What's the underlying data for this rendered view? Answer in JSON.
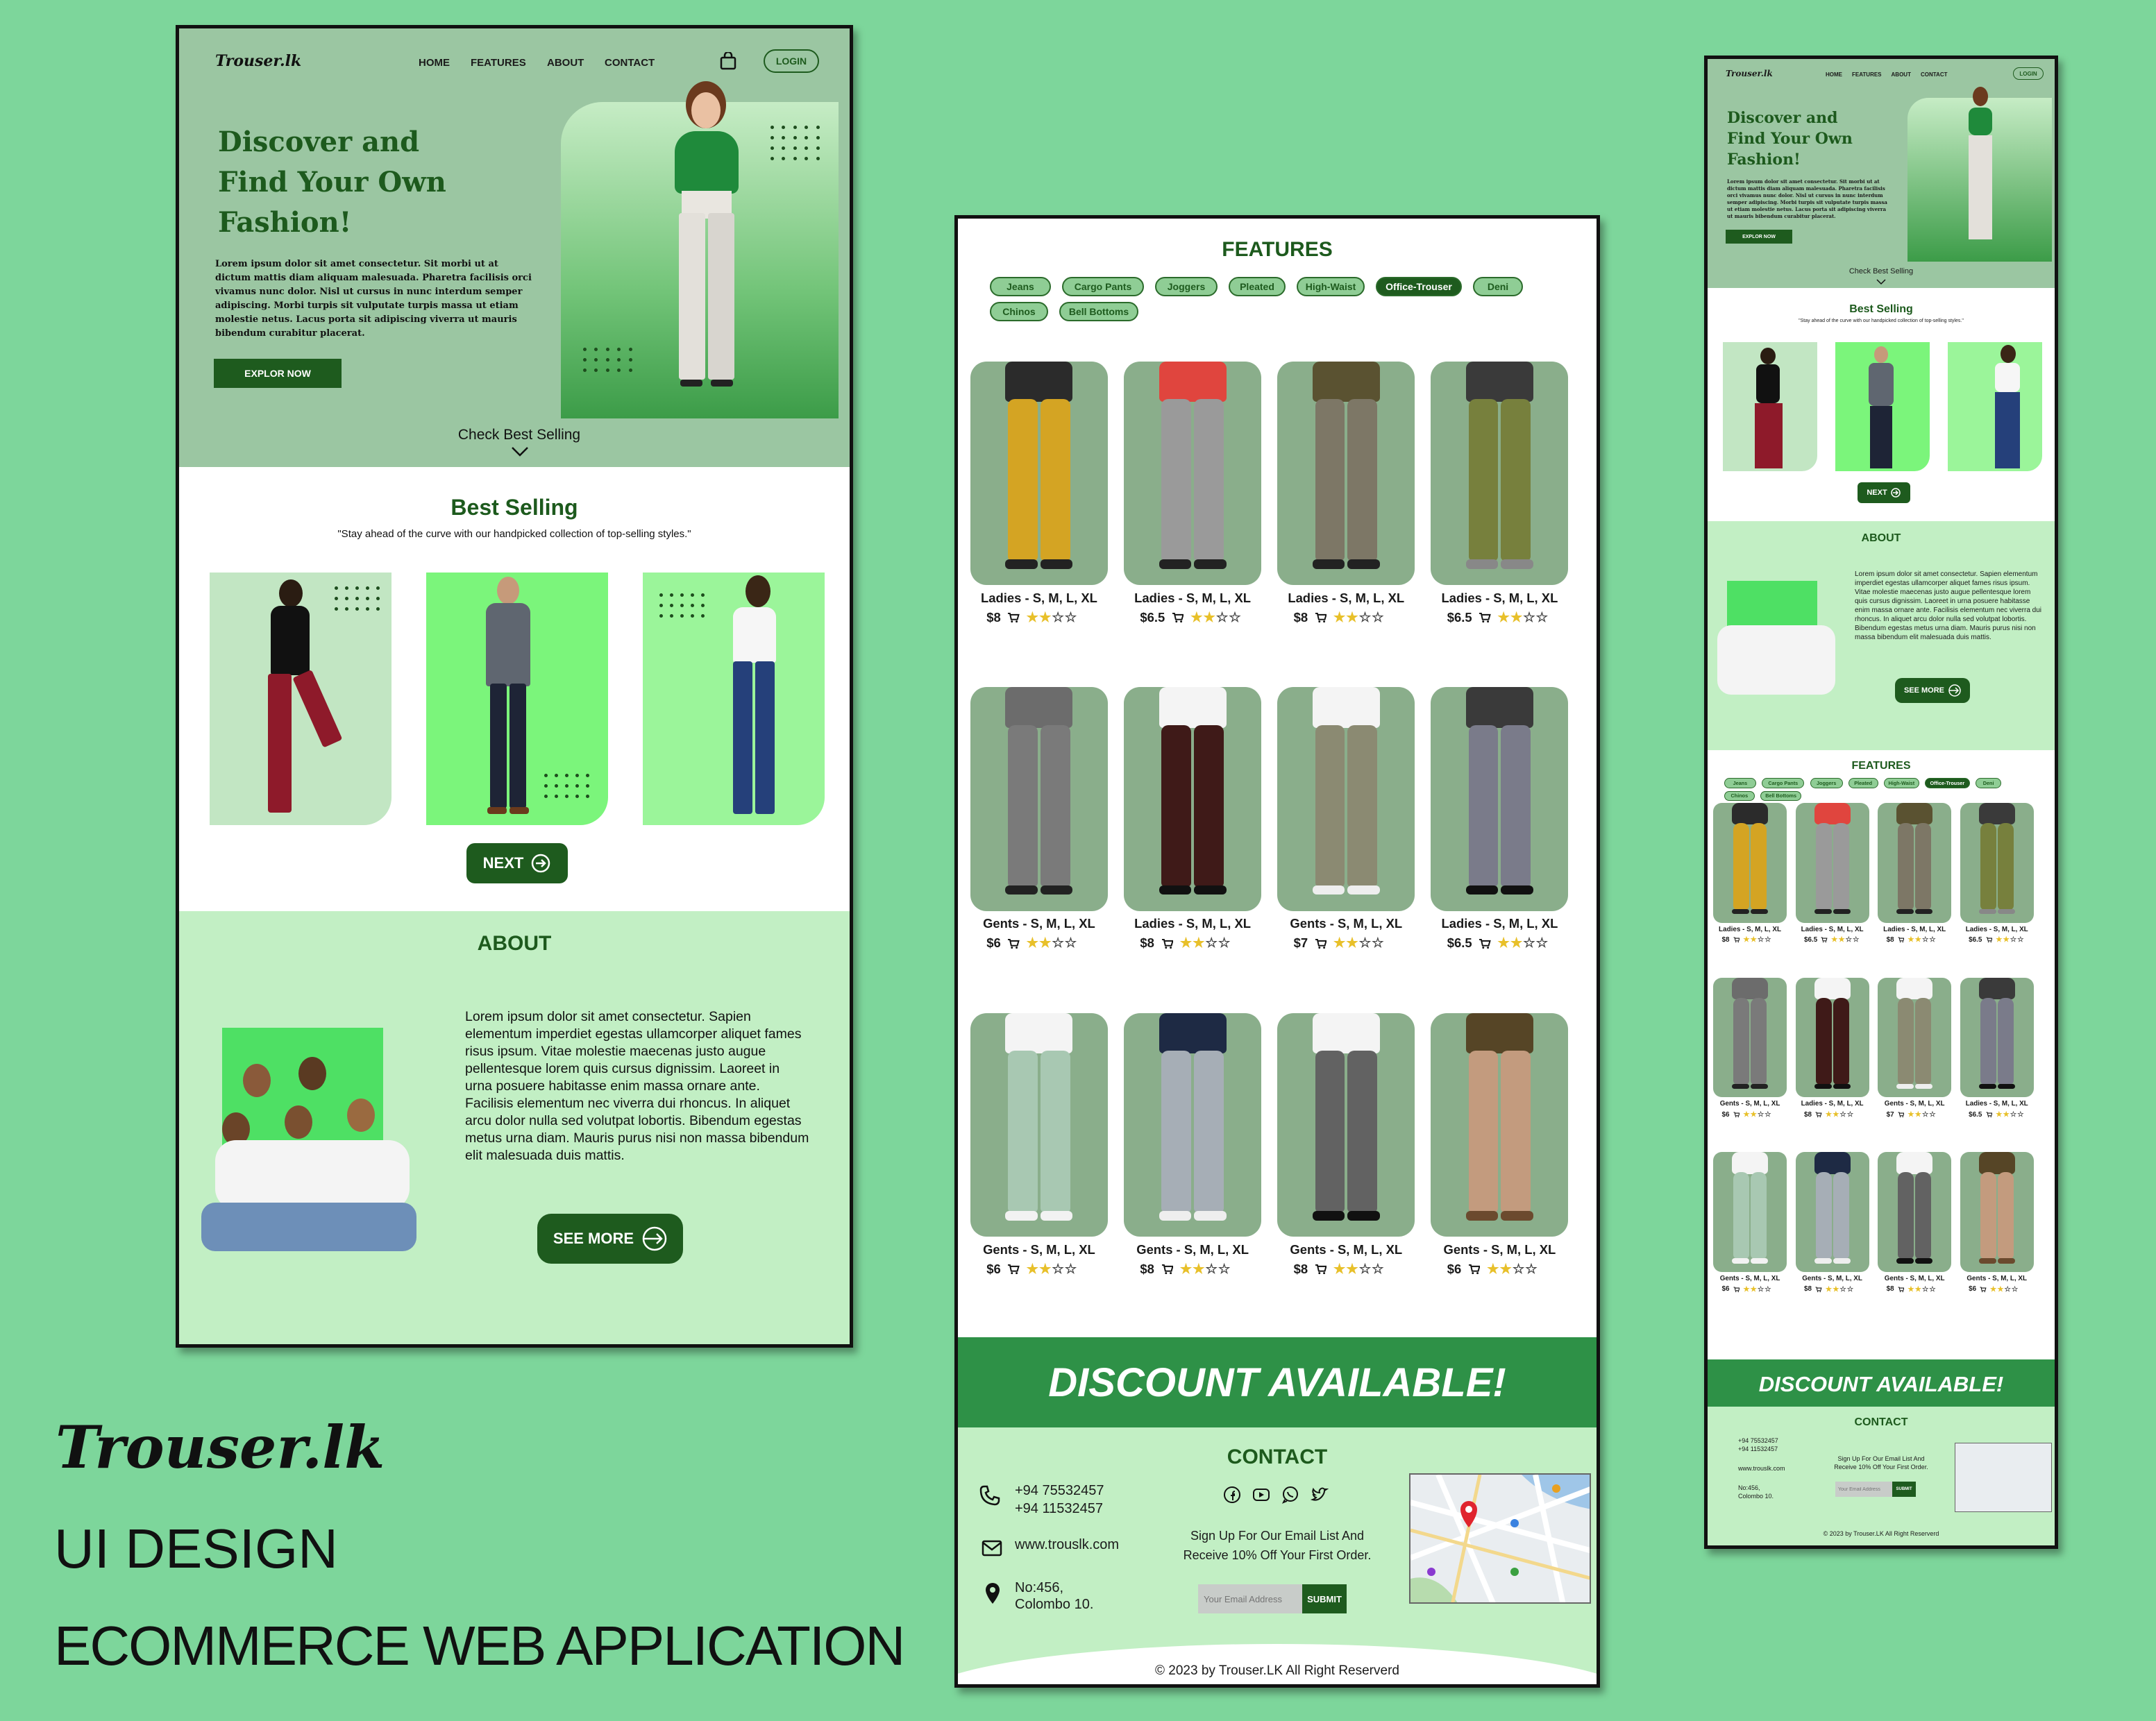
{
  "brand": {
    "title": "Trouser.lk",
    "line1": "UI DESIGN",
    "line2": "ECOMMERCE WEB APPLICATION"
  },
  "colors": {
    "page_bg": "#7dd69b",
    "hero_bg": "#9bc6a2",
    "accent_dark": "#1e5b1e",
    "light_green": "#c2efc4",
    "bright_green": "#7bf57b",
    "card_bg": "#8aae8b",
    "discount_bg": "#2e9147"
  },
  "nav": {
    "logo": "Trouser.lk",
    "items": [
      "HOME",
      "FEATURES",
      "ABOUT",
      "CONTACT"
    ],
    "cart_icon": "shopping-bag-icon",
    "login": "LOGIN"
  },
  "hero": {
    "title_l1": "Discover and",
    "title_l2": "Find Your Own",
    "title_l3": "Fashion!",
    "body": "Lorem ipsum dolor sit amet consectetur. Sit morbi ut at dictum mattis diam aliquam malesuada. Pharetra facilisis orci vivamus nunc dolor. Nisl ut cursus in nunc interdum semper adipiscing. Morbi turpis sit vulputate turpis massa ut etiam molestie netus. Lacus porta sit adipiscing viverra ut mauris bibendum curabitur placerat.",
    "cta": "EXPLOR NOW",
    "check": "Check Best Selling"
  },
  "best": {
    "title": "Best Selling",
    "subtitle": "\"Stay ahead of the curve with our handpicked collection of top-selling styles.\"",
    "next": "NEXT"
  },
  "about": {
    "title": "ABOUT",
    "body": "Lorem ipsum dolor sit amet consectetur. Sapien elementum imperdiet egestas ullamcorper aliquet fames risus ipsum. Vitae molestie maecenas justo augue pellentesque lorem quis cursus dignissim. Laoreet in urna posuere habitasse enim massa ornare ante. Facilisis elementum nec viverra dui rhoncus. In aliquet arcu dolor nulla sed volutpat lobortis. Bibendum egestas metus urna diam. Mauris purus nisi non massa bibendum elit malesuada duis mattis.",
    "cta": "SEE MORE"
  },
  "features": {
    "title": "FEATURES",
    "chips": [
      "Jeans",
      "Cargo Pants",
      "Joggers",
      "Pleated",
      "High-Waist",
      "Office-Trouser",
      "Deni",
      "Chinos",
      "Bell Bottoms"
    ],
    "active": "Office-Trouser"
  },
  "products": [
    {
      "label": "Ladies - S, M, L, XL",
      "price": "$8",
      "rating": 2,
      "top": "#2b2b2b",
      "pants": "#d4a423",
      "shoe": "#222"
    },
    {
      "label": "Ladies - S, M, L, XL",
      "price": "$6.5",
      "rating": 2,
      "top": "#e0453e",
      "pants": "#9a9a9a",
      "shoe": "#222"
    },
    {
      "label": "Ladies - S, M, L, XL",
      "price": "$8",
      "rating": 2,
      "top": "#5a5231",
      "pants": "#7d7766",
      "shoe": "#222"
    },
    {
      "label": "Ladies - S, M, L, XL",
      "price": "$6.5",
      "rating": 2,
      "top": "#3a3a3a",
      "pants": "#77803d",
      "shoe": "#888"
    },
    {
      "label": "Gents - S, M, L, XL",
      "price": "$6",
      "rating": 2,
      "top": "#6c6c6c",
      "pants": "#7a7a7a",
      "shoe": "#222"
    },
    {
      "label": "Ladies - S, M, L, XL",
      "price": "$8",
      "rating": 2,
      "top": "#f4f4f4",
      "pants": "#3f1a18",
      "shoe": "#111"
    },
    {
      "label": "Gents - S, M, L, XL",
      "price": "$7",
      "rating": 2,
      "top": "#f4f4f4",
      "pants": "#8b8a72",
      "shoe": "#eee"
    },
    {
      "label": "Ladies - S, M, L, XL",
      "price": "$6.5",
      "rating": 2,
      "top": "#3a3a3a",
      "pants": "#7a7b8a",
      "shoe": "#111"
    },
    {
      "label": "Gents - S, M, L, XL",
      "price": "$6",
      "rating": 2,
      "top": "#f4f4f4",
      "pants": "#a8c8b2",
      "shoe": "#f2f2f2"
    },
    {
      "label": "Gents - S, M, L, XL",
      "price": "$8",
      "rating": 2,
      "top": "#1e2a44",
      "pants": "#a6aeb6",
      "shoe": "#eee"
    },
    {
      "label": "Gents - S, M, L, XL",
      "price": "$8",
      "rating": 2,
      "top": "#f4f4f4",
      "pants": "#626262",
      "shoe": "#111"
    },
    {
      "label": "Gents - S, M, L, XL",
      "price": "$6",
      "rating": 2,
      "top": "#564526",
      "pants": "#c39b7e",
      "shoe": "#6b4a2e"
    }
  ],
  "discount": "DISCOUNT AVAILABLE!",
  "contact": {
    "title": "CONTACT",
    "phone1": "+94 75532457",
    "phone2": "+94 11532457",
    "web": "www.trouslk.com",
    "addr1": "No:456,",
    "addr2": "Colombo 10.",
    "signup_l1": "Sign Up For Our Email List And",
    "signup_l2": "Receive 10% Off Your First Order.",
    "email_placeholder": "Your Email Address",
    "submit": "SUBMIT",
    "copyright": "2023 by Trouser.LK All Right Reserverd",
    "social": [
      "facebook-icon",
      "youtube-icon",
      "whatsapp-icon",
      "twitter-icon"
    ]
  }
}
